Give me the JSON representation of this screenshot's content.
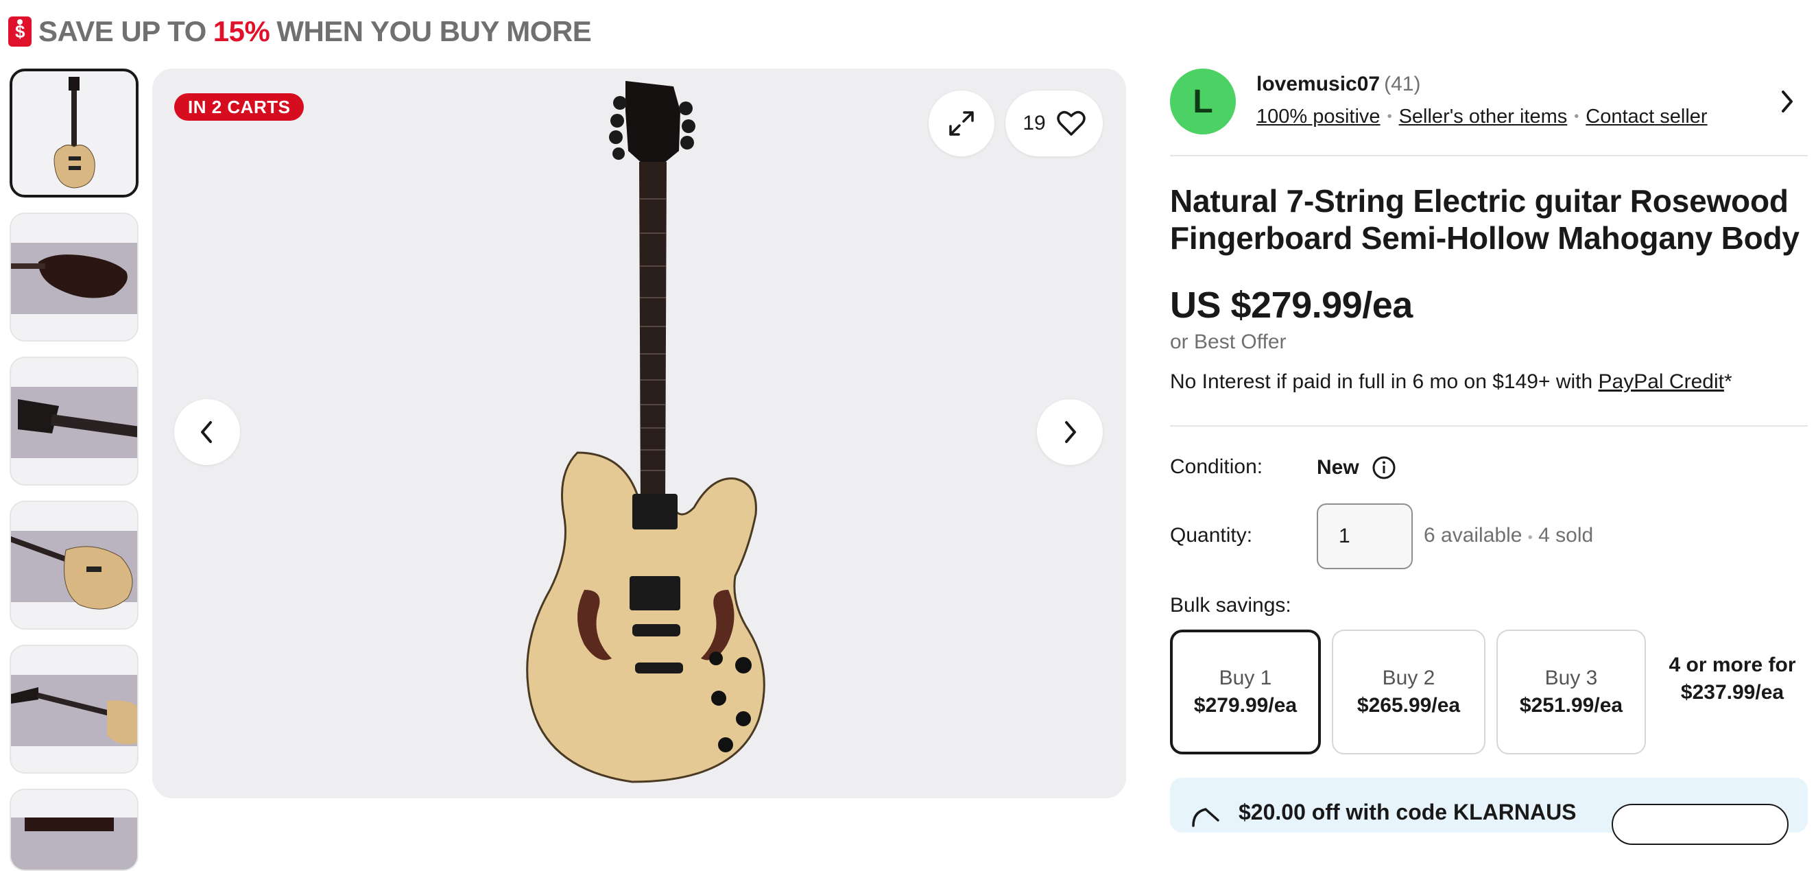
{
  "promo": {
    "icon": "dollar-tag-icon",
    "icon_glyph": "$",
    "prefix": "SAVE UP TO",
    "percent": "15%",
    "suffix": "WHEN YOU BUY MORE",
    "accent_color": "#e0112b"
  },
  "gallery": {
    "badge": "IN 2 CARTS",
    "watch_count": "19",
    "thumbnails": [
      "guitar-front",
      "guitar-back-body",
      "guitar-headstock",
      "guitar-body-angle",
      "guitar-side",
      "guitar-partial"
    ]
  },
  "seller": {
    "avatar_letter": "L",
    "name": "lovemusic07",
    "feedback_count": "(41)",
    "positive": "100% positive",
    "other_items": "Seller's other items",
    "contact": "Contact seller"
  },
  "listing": {
    "title": "Natural 7-String Electric guitar Rosewood Fingerboard Semi-Hollow Mahogany Body",
    "price": "US $279.99/ea",
    "best_offer": "or Best Offer",
    "credit_text": "No Interest if paid in full in 6 mo on $149+ with ",
    "credit_link": "PayPal Credit",
    "credit_suffix": "*",
    "condition_label": "Condition:",
    "condition_value": "New",
    "quantity_label": "Quantity:",
    "quantity_value": "1",
    "available": "6 available",
    "sold": "4 sold",
    "bulk_label": "Bulk savings:",
    "bulk_options": [
      {
        "qty": "Buy 1",
        "price": "$279.99/ea"
      },
      {
        "qty": "Buy 2",
        "price": "$265.99/ea"
      },
      {
        "qty": "Buy 3",
        "price": "$251.99/ea"
      }
    ],
    "bulk_more": "4 or more for $237.99/ea",
    "klarna_text": "$20.00 off with code KLARNAUS"
  }
}
